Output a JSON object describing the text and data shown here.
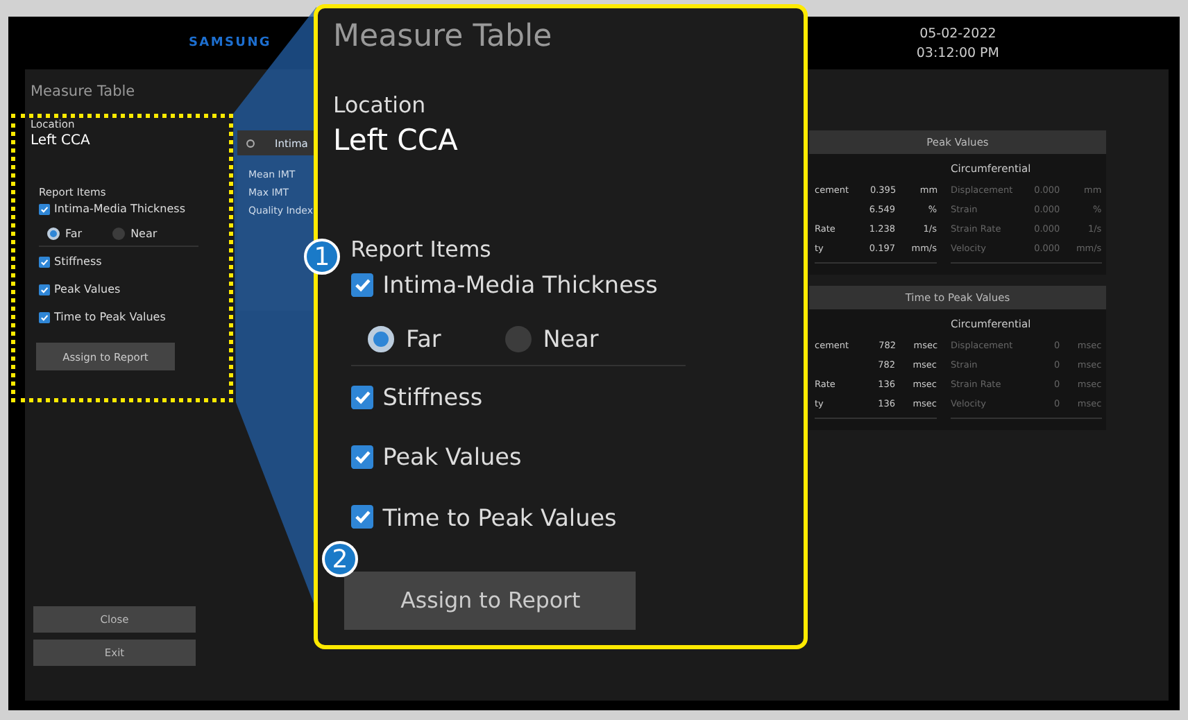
{
  "header": {
    "logo": "SAMSUNG",
    "date": "05-02-2022",
    "time": "03:12:00 PM"
  },
  "measure_table": {
    "title": "Measure Table",
    "location_label": "Location",
    "location": "Left CCA",
    "report_items_label": "Report Items",
    "report_items": [
      {
        "label": "Intima-Media Thickness",
        "checked": true,
        "kind": "options",
        "options": [
          {
            "label": "Far",
            "selected": true
          },
          {
            "label": "Near",
            "selected": false
          }
        ]
      },
      {
        "label": "Stiffness",
        "checked": true,
        "kind": "plain"
      },
      {
        "label": "Peak Values",
        "checked": true,
        "kind": "plain"
      },
      {
        "label": "Time to Peak Values",
        "checked": true,
        "kind": "plain"
      }
    ],
    "assign_button": "Assign to Report"
  },
  "imt_panel": {
    "title": "Intima",
    "rows": [
      "Mean IMT",
      "Max IMT",
      "Quality Index"
    ]
  },
  "result_panels": [
    {
      "title": "Peak Values",
      "columns": [
        {
          "disabled": false,
          "rows": [
            {
              "label": "cement",
              "value": "0.395",
              "unit": "mm"
            },
            {
              "value": "6.549",
              "unit": "%"
            },
            {
              "label": "Rate",
              "value": "1.238",
              "unit": "1/s"
            },
            {
              "label": "ty",
              "value": "0.197",
              "unit": "mm/s"
            }
          ]
        },
        {
          "heading": "Circumferential",
          "disabled": true,
          "rows": [
            {
              "label": "Displacement",
              "value": "0.000",
              "unit": "mm"
            },
            {
              "label": "Strain",
              "value": "0.000",
              "unit": "%"
            },
            {
              "label": "Strain Rate",
              "value": "0.000",
              "unit": "1/s"
            },
            {
              "label": "Velocity",
              "value": "0.000",
              "unit": "mm/s"
            }
          ]
        }
      ]
    },
    {
      "title": "Time to Peak Values",
      "columns": [
        {
          "disabled": false,
          "rows": [
            {
              "label": "cement",
              "value": "782",
              "unit": "msec"
            },
            {
              "value": "782",
              "unit": "msec"
            },
            {
              "label": "Rate",
              "value": "136",
              "unit": "msec"
            },
            {
              "label": "ty",
              "value": "136",
              "unit": "msec"
            }
          ]
        },
        {
          "heading": "Circumferential",
          "disabled": true,
          "rows": [
            {
              "label": "Displacement",
              "value": "0",
              "unit": "msec"
            },
            {
              "label": "Strain",
              "value": "0",
              "unit": "msec"
            },
            {
              "label": "Strain Rate",
              "value": "0",
              "unit": "msec"
            },
            {
              "label": "Velocity",
              "value": "0",
              "unit": "msec"
            }
          ]
        }
      ]
    }
  ],
  "buttons": [
    "Close",
    "Exit"
  ],
  "callout": {
    "title": "Measure Table",
    "location_label": "Location",
    "location": "Left CCA",
    "report_items_label": "Report Items",
    "report_items": [
      {
        "label": "Intima-Media Thickness",
        "checked": true,
        "kind": "options",
        "options": [
          {
            "label": "Far",
            "selected": true
          },
          {
            "label": "Near",
            "selected": false
          }
        ]
      },
      {
        "label": "Stiffness",
        "checked": true,
        "kind": "plain"
      },
      {
        "label": "Peak Values",
        "checked": true,
        "kind": "plain"
      },
      {
        "label": "Time to Peak Values",
        "checked": true,
        "kind": "plain"
      }
    ],
    "assign_button": "Assign to Report"
  },
  "callout_badges": [
    "1",
    "2"
  ]
}
